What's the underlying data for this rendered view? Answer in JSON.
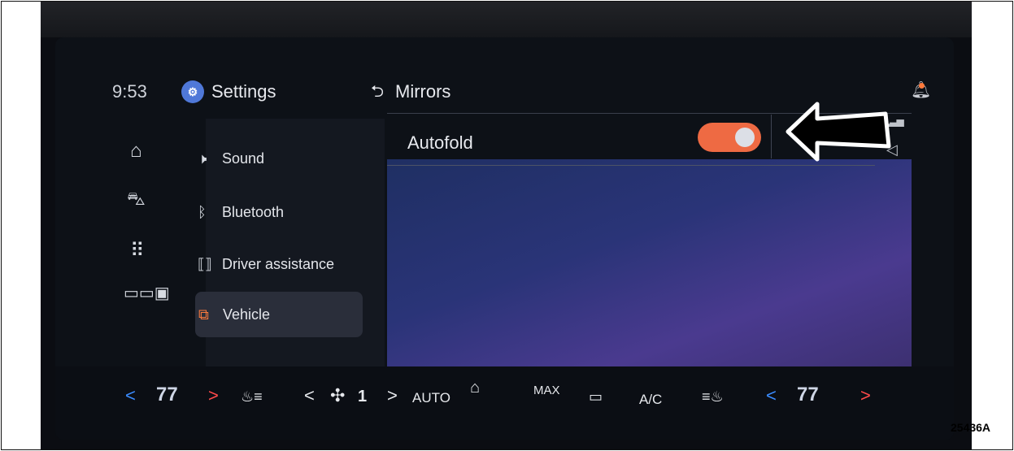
{
  "status": {
    "time": "9:53"
  },
  "header": {
    "app_title": "Settings",
    "back_glyph": "⮌",
    "page_title": "Mirrors"
  },
  "left_rail": [
    {
      "icon": "home-icon",
      "glyph": "⌂"
    },
    {
      "icon": "car-icon",
      "glyph": "🚘"
    },
    {
      "icon": "apps-grid-icon",
      "glyph": "⠿"
    },
    {
      "icon": "vehicle-controls-icon",
      "glyph": "▭"
    }
  ],
  "settings_menu": [
    {
      "label": "Sound",
      "icon": "speaker-icon",
      "glyph": "🕨",
      "active": false
    },
    {
      "label": "Bluetooth",
      "icon": "bluetooth-icon",
      "glyph": "ᛒ",
      "active": false
    },
    {
      "label": "Driver assistance",
      "icon": "driver-assist-icon",
      "glyph": "⟦⟧",
      "active": false
    },
    {
      "label": "Vehicle",
      "icon": "vehicle-icon",
      "glyph": "⧉",
      "active": true
    }
  ],
  "mirrors_panel": {
    "autofold": {
      "label": "Autofold",
      "enabled": true
    }
  },
  "climate_bar": {
    "left_temp": "77",
    "fan_speed": "1",
    "auto_label": "AUTO",
    "max_label": "MAX",
    "ac_label": "A/C",
    "right_temp": "77",
    "left_arrow": "<",
    "right_arrow": ">"
  },
  "figure_id": "25436A",
  "colors": {
    "accent_orange": "#ee6a43",
    "settings_blue": "#4f78d8",
    "temp_down": "#3b8cff",
    "temp_up": "#ff4a4a"
  }
}
